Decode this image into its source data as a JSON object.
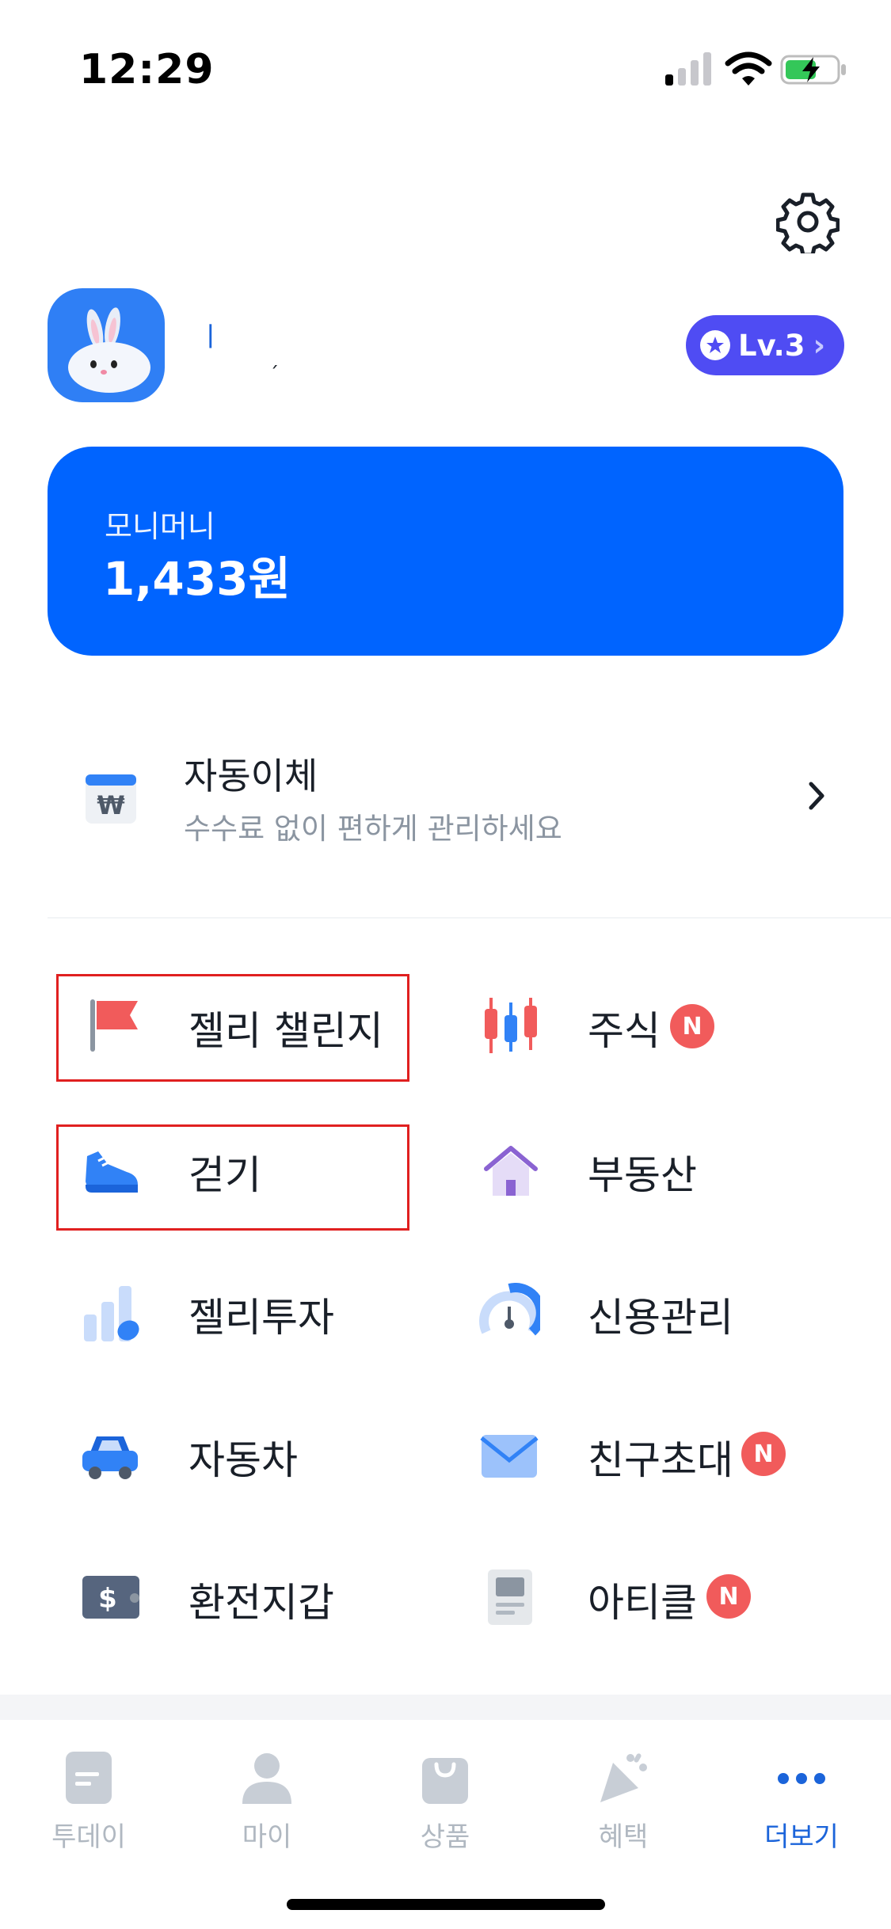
{
  "status_bar": {
    "time": "12:29"
  },
  "profile": {
    "name": "ㅣ",
    "sub": "ˏ",
    "level": "Lv.3"
  },
  "money_card": {
    "label": "모니머니",
    "amount": "1,433원"
  },
  "auto_transfer": {
    "title": "자동이체",
    "subtitle": "수수료 없이 편하게 관리하세요"
  },
  "menu": {
    "jelly_challenge": "젤리 챌린지",
    "stocks": "주식",
    "walking": "걷기",
    "real_estate": "부동산",
    "jelly_invest": "젤리투자",
    "credit": "신용관리",
    "car": "자동차",
    "invite": "친구초대",
    "exchange_wallet": "환전지갑",
    "article": "아티클",
    "new_badge": "N"
  },
  "tabs": {
    "today": "투데이",
    "my": "마이",
    "products": "상품",
    "benefits": "혜택",
    "more": "더보기"
  },
  "colors": {
    "primary": "#0064ff",
    "level": "#4f4cf3",
    "badge": "#f15b5b",
    "highlight": "#e02020",
    "active_tab": "#1b64da"
  }
}
